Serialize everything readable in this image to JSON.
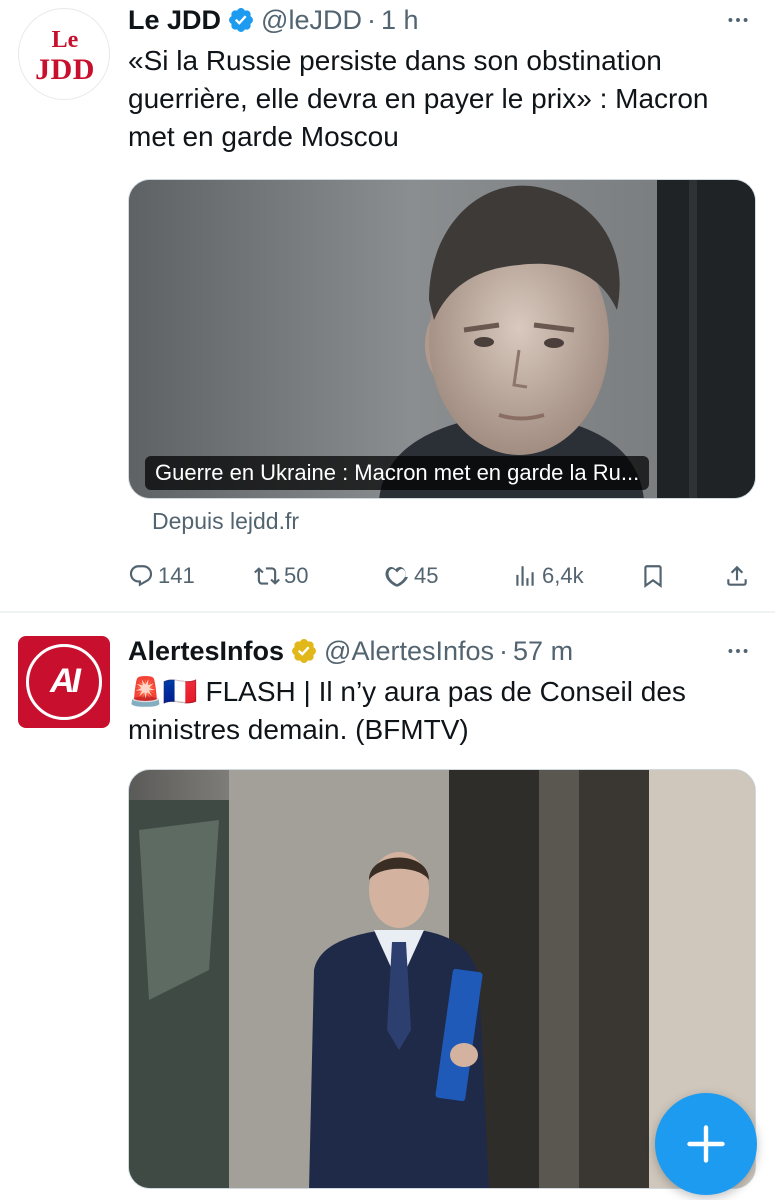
{
  "colors": {
    "accent": "#1d9bf0",
    "verified_blue": "#1d9bf0",
    "verified_gold": "#e2b719",
    "secondary_text": "#536471",
    "brand_red": "#c8102e"
  },
  "tweets": [
    {
      "author": {
        "name": "Le JDD",
        "handle": "@leJDD",
        "badge": "verified-blue",
        "avatar_logo_top": "Le",
        "avatar_logo_bottom": "JDD"
      },
      "time": "1 h",
      "text": "«Si la Russie persiste dans son obstination guerrière, elle devra en payer le prix» : Macron met en garde Moscou",
      "card": {
        "title": "Guerre en Ukraine : Macron met en garde la Ru...",
        "source": "Depuis lejdd.fr",
        "image": "portrait-photo"
      },
      "stats": {
        "replies": "141",
        "retweets": "50",
        "likes": "45",
        "views": "6,4k"
      }
    },
    {
      "author": {
        "name": "AlertesInfos",
        "handle": "@AlertesInfos",
        "badge": "verified-gold",
        "avatar_logo": "AI"
      },
      "time": "57 m",
      "text": "🚨🇫🇷 FLASH | Il n’y aura pas de Conseil des ministres demain. (BFMTV)",
      "media": {
        "image": "man-in-suit-photo"
      }
    }
  ],
  "icons": {
    "dot_separator": "·",
    "fab": "plus-icon"
  }
}
